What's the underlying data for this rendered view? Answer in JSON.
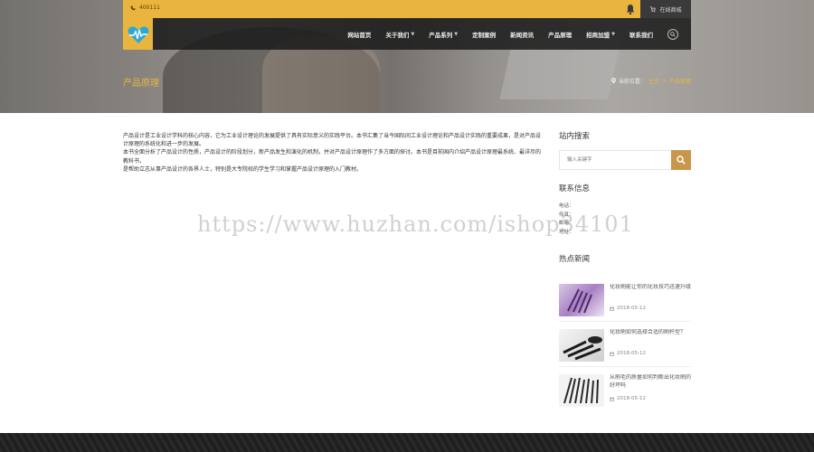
{
  "topbar": {
    "phone": "400111",
    "shop_label": "在线商城"
  },
  "nav": {
    "items": [
      {
        "label": "网站首页",
        "has_caret": false
      },
      {
        "label": "关于我们",
        "has_caret": true
      },
      {
        "label": "产品系列",
        "has_caret": true
      },
      {
        "label": "定制案例",
        "has_caret": false
      },
      {
        "label": "新闻资讯",
        "has_caret": false
      },
      {
        "label": "产品原理",
        "has_caret": false
      },
      {
        "label": "招商加盟",
        "has_caret": true
      },
      {
        "label": "联系我们",
        "has_caret": false
      }
    ]
  },
  "page": {
    "title": "产品原理",
    "breadcrumb": {
      "prefix": "当前位置：",
      "home": "主页",
      "sep": ">",
      "current": "产品原理"
    }
  },
  "content": {
    "paragraphs": [
      "产品设计是工业设计学科的核心内容，它为工业设计理论的发展提供了具有实际意义的实践平台。本书汇集了当今国际间工业设计理论和产品设计实践的重要成果，是对产品设计原理的系统化和进一步的发展。",
      "本书全面分析了产品设计的性质，产品设计的阶段划分，新产品发生和演化的机制，并对产品设计原理作了多方面的探讨。本书是目前国内介绍产品设计原理最系统、最详尽的教科书，",
      "是帮助立志从事产品设计的各界人士，特别是大专院校的学生学习和掌握产品设计原理的入门教材。"
    ]
  },
  "sidebar": {
    "search": {
      "title": "站内搜索",
      "placeholder": "输入关键字"
    },
    "contact": {
      "title": "联系信息",
      "lines": [
        "电话：",
        "传真：",
        "邮箱：",
        "地址："
      ]
    },
    "news": {
      "title": "热点新闻",
      "items": [
        {
          "title": "化妆刷能让你的化妆技巧迅速升级",
          "date": "2018-05-12"
        },
        {
          "title": "化妆刷如何选择合适的刷杆型？",
          "date": "2018-05-12"
        },
        {
          "title": "从刷毛的质量如何判断出化妆刷的好坏吗",
          "date": "2018-05-12"
        }
      ]
    }
  },
  "watermark": "https://www.huzhan.com/ishop34101",
  "colors": {
    "accent": "#e9b53f",
    "nav_bg": "#1c1c1c",
    "search_btn": "#c8984a",
    "footer": "#1f1f1f"
  },
  "icons": {
    "phone": "phone-icon",
    "bell": "bell-icon",
    "cart": "cart-icon",
    "logo": "heartbeat-logo-icon",
    "search": "search-icon",
    "location": "location-pin-icon",
    "calendar": "calendar-icon"
  }
}
